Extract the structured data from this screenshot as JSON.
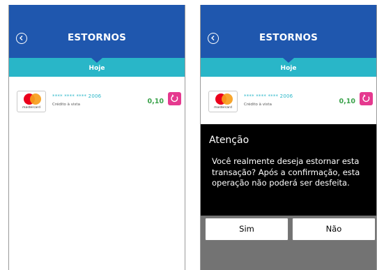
{
  "left_screen": {
    "header": {
      "title": "ESTORNOS",
      "back_icon": "back-arrow-circle-icon"
    },
    "section_label": "Hoje",
    "transaction": {
      "card_brand": "mastercard",
      "masked_card": "**** **** **** 2006",
      "type": "Crédito à vista",
      "amount": "0,10",
      "action_icon": "refund-icon"
    }
  },
  "right_screen": {
    "header": {
      "title": "ESTORNOS",
      "back_icon": "back-arrow-circle-icon"
    },
    "section_label": "Hoje",
    "transaction": {
      "card_brand": "mastercard",
      "masked_card": "**** **** **** 2006",
      "type": "Crédito à vista",
      "amount": "0,10",
      "action_icon": "refund-icon"
    },
    "dialog": {
      "title": "Atenção",
      "message": "Você realmente deseja estornar esta transação? Após a confirmação, esta operação não poderá ser desfeita.",
      "confirm_label": "Sim",
      "cancel_label": "Não"
    }
  },
  "colors": {
    "header_blue": "#1f57ae",
    "subbar_teal": "#29b6c8",
    "amount_green": "#3aa24a",
    "refund_pink": "#e5398f",
    "dialog_black": "#000000"
  }
}
